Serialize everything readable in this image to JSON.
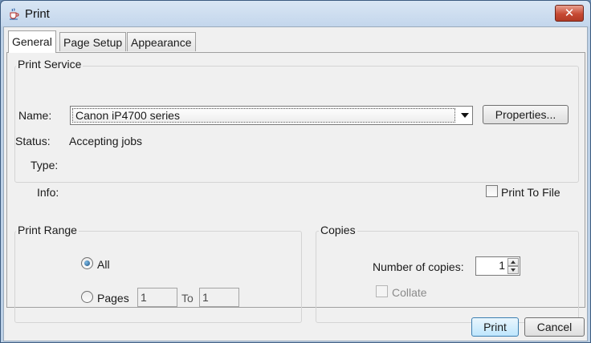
{
  "window": {
    "title": "Print",
    "close_glyph": "✕"
  },
  "tabs": [
    {
      "label": "General",
      "active": true
    },
    {
      "label": "Page Setup",
      "active": false
    },
    {
      "label": "Appearance",
      "active": false
    }
  ],
  "print_service": {
    "group_title": "Print Service",
    "name_label": "Name:",
    "printer_name": "Canon iP4700 series",
    "properties_button": "Properties...",
    "status_label": "Status:",
    "status_value": "Accepting jobs",
    "type_label": "Type:",
    "type_value": "",
    "info_label": "Info:",
    "info_value": "",
    "print_to_file_label": "Print To File",
    "print_to_file_checked": false
  },
  "print_range": {
    "group_title": "Print Range",
    "all_label": "All",
    "all_selected": true,
    "pages_label": "Pages",
    "pages_from": "1",
    "to_label": "To",
    "pages_to": "1"
  },
  "copies": {
    "group_title": "Copies",
    "number_label": "Number of copies:",
    "number_value": "1",
    "collate_label": "Collate",
    "collate_checked": false,
    "collate_enabled": false
  },
  "footer": {
    "print_button": "Print",
    "cancel_button": "Cancel"
  },
  "icons": [
    "java-coffee-icon",
    "close-icon",
    "dropdown-arrow-icon",
    "spinner-up-icon",
    "spinner-down-icon"
  ],
  "colors": {
    "titlebar": "#c3d6ec",
    "close_button": "#c74a34",
    "default_button": "#bee6fd",
    "radio_selected": "#1c5181"
  }
}
